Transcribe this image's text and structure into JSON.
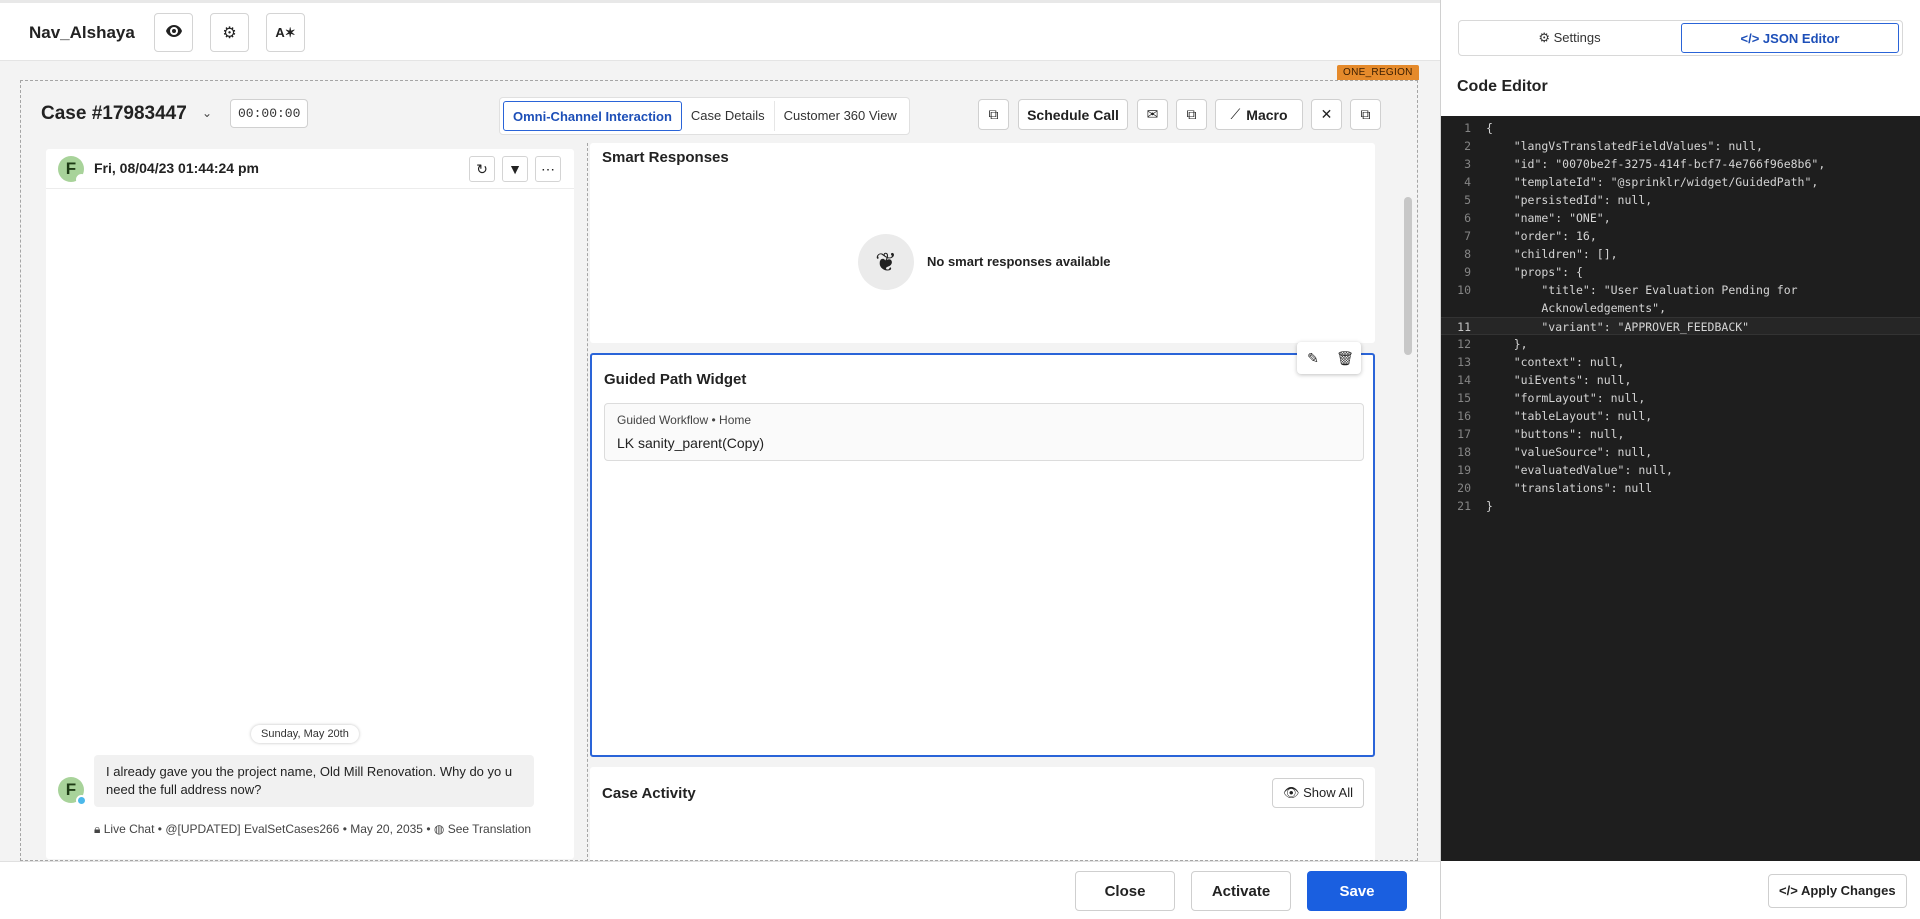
{
  "app": {
    "title": "Nav_Alshaya"
  },
  "region_tag": "ONE_REGION",
  "case": {
    "number": "Case #17983447",
    "timer": "00:00:00",
    "tabs": [
      "Omni-Channel Interaction",
      "Case Details",
      "Customer 360 View"
    ],
    "active_tab": "Omni-Channel Interaction",
    "schedule_call_label": "Schedule Call",
    "macro_label": "Macro"
  },
  "conversation": {
    "avatar_initial": "F",
    "header_date": "Fri, 08/04/23 01:44:24 pm",
    "day_chip": "Sunday, May 20th",
    "message": "I already gave you the project name, Old Mill Renovation. Why do yo u need the full address now?",
    "meta_channel": "Live Chat",
    "meta_account": "@[UPDATED] EvalSetCases266",
    "meta_date": "May 20, 2035",
    "meta_translate": "See Translation"
  },
  "smart_responses": {
    "title": "Smart Responses",
    "empty_text": "No smart responses available"
  },
  "guided_path": {
    "title": "Guided Path Widget",
    "crumb_workflow": "Guided Workflow",
    "crumb_home": "Home",
    "item_name": "LK sanity_parent(Copy)"
  },
  "case_activity": {
    "title": "Case Activity",
    "show_all_label": "Show All"
  },
  "footer": {
    "close_label": "Close",
    "activate_label": "Activate",
    "save_label": "Save"
  },
  "right_panel": {
    "tabs": [
      "Settings",
      "JSON Editor"
    ],
    "active_tab": "JSON Editor",
    "title": "Code Editor",
    "apply_label": "Apply Changes",
    "current_line": 11,
    "code_lines": [
      {
        "n": "1",
        "t": "{"
      },
      {
        "n": "2",
        "t": "    \"langVsTranslatedFieldValues\": null,"
      },
      {
        "n": "3",
        "t": "    \"id\": \"0070be2f-3275-414f-bcf7-4e766f96e8b6\","
      },
      {
        "n": "4",
        "t": "    \"templateId\": \"@sprinklr/widget/GuidedPath\","
      },
      {
        "n": "5",
        "t": "    \"persistedId\": null,"
      },
      {
        "n": "6",
        "t": "    \"name\": \"ONE\","
      },
      {
        "n": "7",
        "t": "    \"order\": 16,"
      },
      {
        "n": "8",
        "t": "    \"children\": [],"
      },
      {
        "n": "9",
        "t": "    \"props\": {"
      },
      {
        "n": "10",
        "t": "        \"title\": \"User Evaluation Pending for"
      },
      {
        "n": "",
        "t": "        Acknowledgements\","
      },
      {
        "n": "11",
        "t": "        \"variant\": \"APPROVER_FEEDBACK\""
      },
      {
        "n": "12",
        "t": "    },"
      },
      {
        "n": "13",
        "t": "    \"context\": null,"
      },
      {
        "n": "14",
        "t": "    \"uiEvents\": null,"
      },
      {
        "n": "15",
        "t": "    \"formLayout\": null,"
      },
      {
        "n": "16",
        "t": "    \"tableLayout\": null,"
      },
      {
        "n": "17",
        "t": "    \"buttons\": null,"
      },
      {
        "n": "18",
        "t": "    \"valueSource\": null,"
      },
      {
        "n": "19",
        "t": "    \"evaluatedValue\": null,"
      },
      {
        "n": "20",
        "t": "    \"translations\": null"
      },
      {
        "n": "21",
        "t": "}"
      }
    ]
  }
}
